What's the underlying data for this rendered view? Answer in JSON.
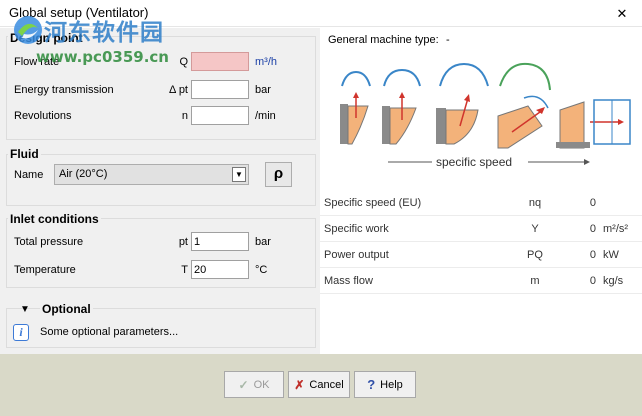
{
  "window": {
    "title": "Global setup (Ventilator)",
    "close_glyph": "✕"
  },
  "watermark": {
    "site": "河东软件园",
    "url": "www.pc0359.cn"
  },
  "design_point": {
    "title": "Design point",
    "flow_rate": {
      "label": "Flow rate",
      "symbol": "Q",
      "value": "",
      "unit": "m³/h"
    },
    "energy_transmission": {
      "label": "Energy transmission",
      "symbol": "Δ pt",
      "value": "",
      "unit": "bar"
    },
    "revolutions": {
      "label": "Revolutions",
      "symbol": "n",
      "value": "",
      "unit": "/min"
    }
  },
  "fluid": {
    "title": "Fluid",
    "name_label": "Name",
    "selected": "Air (20°C)",
    "rho_button": "ρ"
  },
  "inlet": {
    "title": "Inlet conditions",
    "total_pressure": {
      "label": "Total pressure",
      "symbol": "pt",
      "value": "1",
      "unit": "bar"
    },
    "temperature": {
      "label": "Temperature",
      "symbol": "T",
      "value": "20",
      "unit": "°C"
    }
  },
  "optional": {
    "title": "Optional",
    "text": "Some optional parameters...",
    "info_icon": "i",
    "expand_glyph": "▼"
  },
  "machine": {
    "label": "General machine type:",
    "value": "-",
    "axis_label": "specific speed"
  },
  "results": [
    {
      "label": "Specific speed (EU)",
      "symbol": "nq",
      "value": "0",
      "unit": ""
    },
    {
      "label": "Specific work",
      "symbol": "Y",
      "value": "0",
      "unit": "m²/s²"
    },
    {
      "label": "Power output",
      "symbol": "PQ",
      "value": "0",
      "unit": "kW"
    },
    {
      "label": "Mass flow",
      "symbol": "m",
      "value": "0",
      "unit": "kg/s"
    }
  ],
  "buttons": {
    "ok": "OK",
    "cancel": "Cancel",
    "help": "Help",
    "ok_icon": "✓",
    "cancel_icon": "✗",
    "help_icon": "?"
  },
  "colors": {
    "required_field": "#f5c6c6",
    "impeller": "#f3b27a",
    "footer": "#d9d9c8"
  }
}
